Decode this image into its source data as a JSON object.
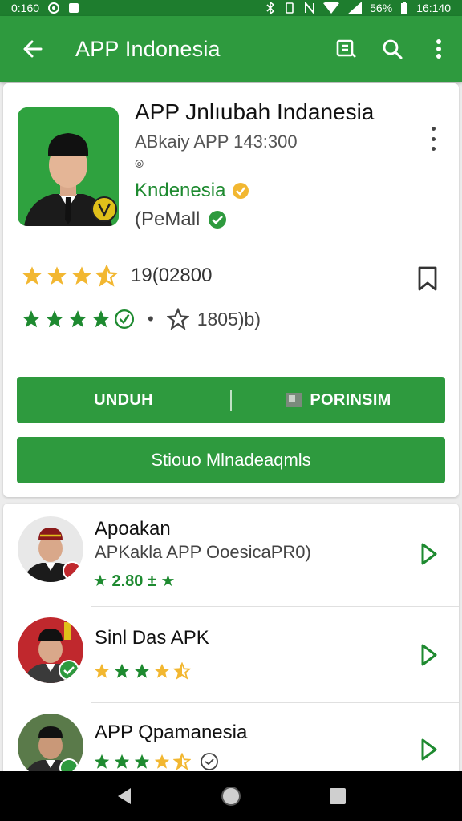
{
  "status_bar": {
    "left_text": "0:160",
    "battery": "56%",
    "time": "16:140"
  },
  "appbar": {
    "title": "APP Indonesia"
  },
  "app": {
    "title": "APP Jnlıubah Indanesia",
    "subtitle": "ABkaiy APP 143:300",
    "mini": "⦾",
    "developer": "Kndenesia",
    "mail": "(PeMall",
    "rating_count": "19(02800",
    "secondary_rating": "1805)b)",
    "colors": {
      "primary": "#2e9a3e",
      "star": "#f2b731",
      "dev": "#1e8a30"
    }
  },
  "buttons": {
    "download": "UNDUH",
    "portfolio": "PORINSIM",
    "store": "Stiouo Mlnadeaqmls"
  },
  "list": [
    {
      "title": "Apoakan",
      "subtitle": "APKakla APP OoesicaPR0)",
      "meta": "★ 2.80 ± ★",
      "icon": "chevron-right-icon"
    },
    {
      "title": "Sinl Das APK",
      "subtitle": "",
      "meta": "",
      "icon": "chevron-right-icon"
    },
    {
      "title": "APP Qpamanesia",
      "subtitle": "",
      "meta": "",
      "icon": "chevron-right-icon"
    }
  ]
}
